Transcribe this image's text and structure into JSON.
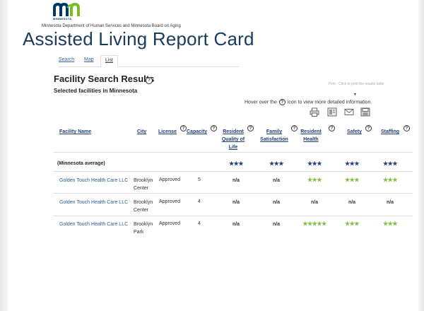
{
  "header": {
    "logo_word": "MINNESOTA",
    "department": "Minnesota Department of Human Services and Minnesota Board on Aging",
    "title": "Assisted Living Report Card"
  },
  "tabs": [
    {
      "label": "Search"
    },
    {
      "label": "Map"
    },
    {
      "label": "List"
    }
  ],
  "results": {
    "title": "Facility Search Results",
    "selected": "Selected facilities in Minnesota",
    "print_hint": "Print - Click to print the results table",
    "hover_hint_before": "Hover over the",
    "hover_hint_after": "icon to view more detailed information."
  },
  "table": {
    "headers": {
      "facility_name": "Facility Name",
      "city": "City",
      "license": "License",
      "capacity": "Capacity",
      "resident_quality": "Resident Quality of Life",
      "family_satisfaction": "Family Satisfaction",
      "resident_health": "Resident Health",
      "safety": "Safety",
      "staffing": "Staffing"
    },
    "average_row": {
      "label": "(Minnesota average)",
      "ratings": [
        "★★★",
        "★★★",
        "★★★",
        "★★★",
        "★★★"
      ]
    },
    "rows": [
      {
        "name": "Golden Touch Health Care LLC",
        "city": "Brooklyn Center",
        "license": "Approved",
        "capacity": "5",
        "ratings": [
          "n/a",
          "n/a",
          "★★★",
          "★★★",
          "★★★"
        ]
      },
      {
        "name": "Golden Touch Health Care LLC",
        "city": "Brooklyn Center",
        "license": "Approved",
        "capacity": "4",
        "ratings": [
          "n/a",
          "n/a",
          "n/a",
          "n/a",
          "n/a"
        ]
      },
      {
        "name": "Golden Touch Health Care LLC",
        "city": "Brooklyn Park",
        "license": "Approved",
        "capacity": "4",
        "ratings": [
          "n/a",
          "n/a",
          "★★★★★",
          "★★★",
          "★★★"
        ]
      }
    ]
  },
  "colors": {
    "title": "#1b3a5c",
    "link": "#2b5a8f",
    "star_average": "#1f3f77",
    "star_facility": "#7fbf3f"
  }
}
